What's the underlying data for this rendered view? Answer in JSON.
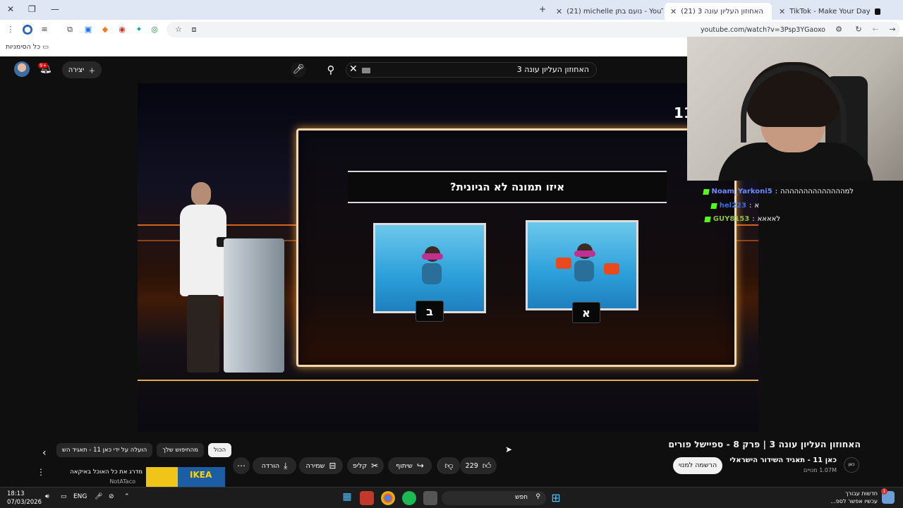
{
  "browser": {
    "tabs": [
      {
        "title": "TikTok - Make Your Day",
        "favicon": "tiktok-icon"
      },
      {
        "title": "(21) האחוזון העליון עונה 3",
        "favicon": "youtube-icon",
        "active": true
      },
      {
        "title": "(21) michelle נועם בתן - YouTube",
        "favicon": "youtube-icon"
      }
    ],
    "url": "youtube.com/watch?v=3Psp3YGaoxo",
    "bookmarks_all": "כל הסימניות"
  },
  "youtube": {
    "search_query": "האחוזון העליון עונה 3",
    "create_label": "יצירה",
    "notifications_badge": "9+"
  },
  "video": {
    "question": "איזו תמונה לא הגיונית?",
    "option_a": "א",
    "option_b": "ב",
    "corner_number": "11"
  },
  "chat": {
    "messages": [
      {
        "user": "Noam_Yarkoni5",
        "text": "למהההההההההההההה",
        "color": "#6c8cff"
      },
      {
        "user": "hel223",
        "text": "א",
        "color": "#3b6fe0"
      },
      {
        "user": "GUY8153",
        "text": "לאאאא",
        "color": "#8fbf3f"
      }
    ]
  },
  "below_video": {
    "title": "האחוזון העליון עונה 3 | פרק 8 - ספיישל פורים",
    "channel_name": "כאן 11 - תאגיד השידור הישראלי",
    "channel_avatar_text": "כאן",
    "subscribers": "1.07M מנויים",
    "subscribe_label": "הרשמה למנוי",
    "likes": "229",
    "share_label": "שיתוף",
    "clip_label": "קליפ",
    "save_label": "שמירה",
    "download_label": "הורדה",
    "chips": [
      "הכול",
      "מהחיפוש שלך",
      "הועלה על ידי כאן 11 - תאגיד הש"
    ],
    "rec_title": "מדרג את כל האוכל באיקאה",
    "rec_channel": "NotATaco",
    "rec_thumb_text": "IKEA"
  },
  "taskbar": {
    "time": "18:13",
    "date": "07/03/2026",
    "language": "ENG",
    "search_placeholder": "חפש",
    "news_title": "חדשות עבורך",
    "news_sub": "עכשיו אפשר לספ...",
    "news_badge": "1"
  }
}
